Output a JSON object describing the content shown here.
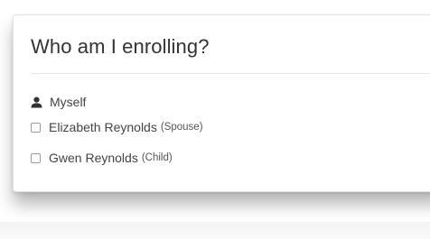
{
  "enrollment": {
    "title": "Who am I enrolling?",
    "options": [
      {
        "name": "Myself",
        "relation": "",
        "type": "self-icon"
      },
      {
        "name": "Elizabeth Reynolds",
        "relation": "(Spouse)",
        "type": "checkbox",
        "checked": false
      },
      {
        "name": "Gwen Reynolds",
        "relation": "(Child)",
        "type": "checkbox",
        "checked": false
      }
    ]
  },
  "icons": {
    "self": "person-icon"
  },
  "colors": {
    "title_text": "#333333",
    "body_text": "#444444",
    "divider": "#e6e6e6",
    "checkbox_border": "#9a9a9a"
  }
}
